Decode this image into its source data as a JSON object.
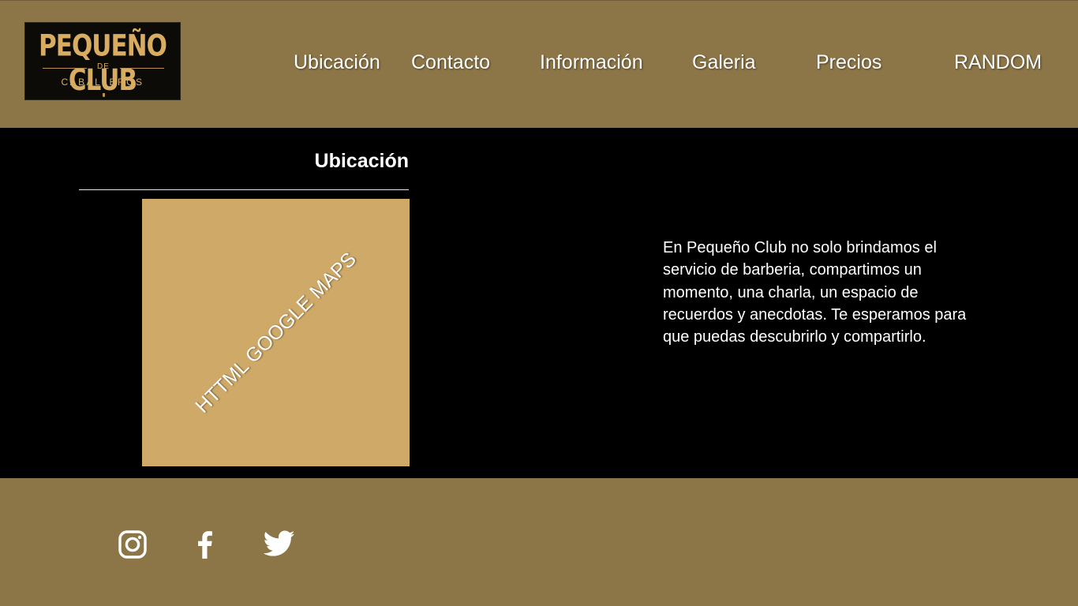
{
  "brand": {
    "logo_title": "PEQUEÑO CLUB",
    "logo_de": "DE",
    "logo_subtitle": "CABALLEROS"
  },
  "nav": {
    "items": [
      {
        "label": "Ubicación"
      },
      {
        "label": "Contacto"
      },
      {
        "label": "Información"
      },
      {
        "label": "Galeria"
      },
      {
        "label": "Precios"
      },
      {
        "label": "RANDOM"
      }
    ]
  },
  "section": {
    "title": "Ubicación",
    "map_placeholder": "HTTML GOOGLE MAPS",
    "description": "En Pequeño Club no solo brindamos el servicio de barberia, compartimos un momento, una charla, un espacio de recuerdos y anecdotas. Te esperamos para que puedas descubrirlo y compartirlo."
  },
  "footer": {
    "social_icons": [
      "instagram-icon",
      "facebook-icon",
      "twitter-icon"
    ]
  },
  "colors": {
    "header_bg": "#8c7546",
    "main_bg": "#000000",
    "map_bg": "#cfa968",
    "logo_gold": "#d8ad62"
  }
}
